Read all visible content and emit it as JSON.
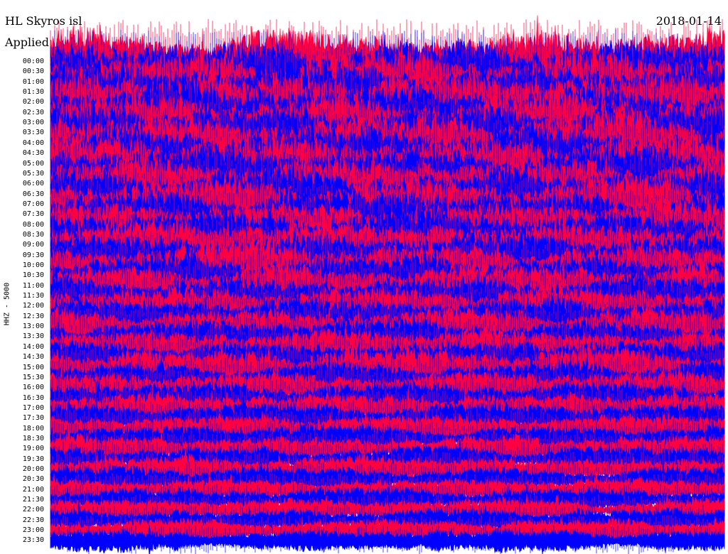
{
  "header": {
    "station": "HL Skyros isl",
    "date": "2018-01-14",
    "filter": "Applied"
  },
  "channel_label": "HHZ - 5000",
  "colors": {
    "trace_a": "#0000ff",
    "trace_b": "#ff0040",
    "background": "#ffffff",
    "text": "#000000"
  },
  "chart_data": {
    "type": "line",
    "title": "HL Skyros isl",
    "ylabel": "HHZ - 5000",
    "time_labels": [
      "00:00",
      "00:30",
      "01:00",
      "01:30",
      "02:00",
      "02:30",
      "03:00",
      "03:30",
      "04:00",
      "04:30",
      "05:00",
      "05:30",
      "06:00",
      "06:30",
      "07:00",
      "07:30",
      "08:00",
      "08:30",
      "09:00",
      "09:30",
      "10:00",
      "10:30",
      "11:00",
      "11:30",
      "12:00",
      "12:30",
      "13:00",
      "13:30",
      "14:00",
      "14:30",
      "15:00",
      "15:30",
      "16:00",
      "16:30",
      "17:00",
      "17:30",
      "18:00",
      "18:30",
      "19:00",
      "19:30",
      "20:00",
      "20:30",
      "21:00",
      "21:30",
      "22:00",
      "22:30",
      "23:00",
      "23:30"
    ],
    "series": [
      {
        "values": [
          1.0,
          1.0,
          0.98,
          0.97,
          0.96,
          0.95,
          0.94,
          0.93,
          0.92,
          0.9,
          0.88,
          0.86,
          0.82,
          0.8,
          0.78,
          0.75,
          0.72,
          0.7,
          0.68,
          0.66,
          0.64,
          0.62,
          0.6,
          0.58,
          0.56,
          0.54,
          0.52,
          0.5,
          0.48,
          0.47,
          0.46,
          0.45,
          0.44,
          0.43,
          0.42,
          0.41,
          0.38,
          0.35,
          0.33,
          0.32,
          0.31,
          0.3,
          0.28,
          0.27,
          0.26,
          0.25,
          0.24,
          0.24
        ]
      }
    ]
  }
}
